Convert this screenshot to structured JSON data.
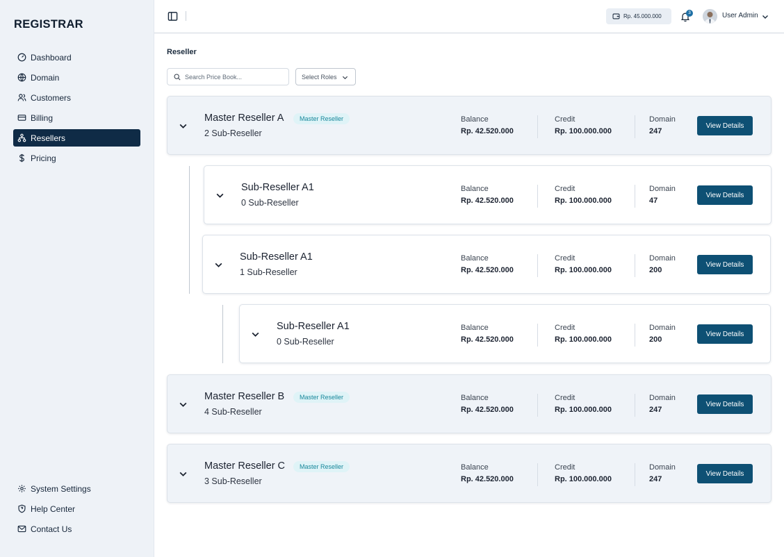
{
  "brand": "REGISTRAR",
  "nav": [
    {
      "label": "Dashboard",
      "icon": "dashboard-icon"
    },
    {
      "label": "Domain",
      "icon": "globe-icon"
    },
    {
      "label": "Customers",
      "icon": "users-icon"
    },
    {
      "label": "Billing",
      "icon": "card-icon"
    },
    {
      "label": "Resellers",
      "icon": "network-icon",
      "active": true
    },
    {
      "label": "Pricing",
      "icon": "dollar-icon"
    }
  ],
  "nav_bottom": [
    {
      "label": "System Settings",
      "icon": "gear-icon"
    },
    {
      "label": "Help Center",
      "icon": "shield-icon"
    },
    {
      "label": "Contact Us",
      "icon": "mail-icon"
    }
  ],
  "header": {
    "balance": "Rp. 45.000.000",
    "notification_count": "3",
    "user_name": "User Admin"
  },
  "page": {
    "title": "Reseller",
    "search_placeholder": "Search Price Book...",
    "roles_label": "Select Roles"
  },
  "labels": {
    "balance": "Balance",
    "credit": "Credit",
    "domain": "Domain",
    "view_details": "View Details",
    "master_badge": "Master Reseller"
  },
  "resellers": [
    {
      "name": "Master Reseller A",
      "sub": "2 Sub-Reseller",
      "master": true,
      "balance": "Rp. 42.520.000",
      "credit": "Rp. 100.000.000",
      "domain": "247"
    },
    {
      "name": "Sub-Reseller A1",
      "sub": "0 Sub-Reseller",
      "master": false,
      "balance": "Rp. 42.520.000",
      "credit": "Rp. 100.000.000",
      "domain": "47"
    },
    {
      "name": "Sub-Reseller A1",
      "sub": "1 Sub-Reseller",
      "master": false,
      "balance": "Rp. 42.520.000",
      "credit": "Rp. 100.000.000",
      "domain": "200"
    },
    {
      "name": "Sub-Reseller A1",
      "sub": "0 Sub-Reseller",
      "master": false,
      "balance": "Rp. 42.520.000",
      "credit": "Rp. 100.000.000",
      "domain": "200"
    },
    {
      "name": "Master Reseller B",
      "sub": "4 Sub-Reseller",
      "master": true,
      "balance": "Rp. 42.520.000",
      "credit": "Rp. 100.000.000",
      "domain": "247"
    },
    {
      "name": "Master Reseller C",
      "sub": "3 Sub-Reseller",
      "master": true,
      "balance": "Rp. 42.520.000",
      "credit": "Rp. 100.000.000",
      "domain": "247"
    }
  ],
  "colors": {
    "sidebar_bg": "#eef2f7",
    "active_nav": "#0f2b46",
    "button": "#0e5074",
    "badge_bg": "#dff3f7",
    "badge_text": "#17879b"
  }
}
